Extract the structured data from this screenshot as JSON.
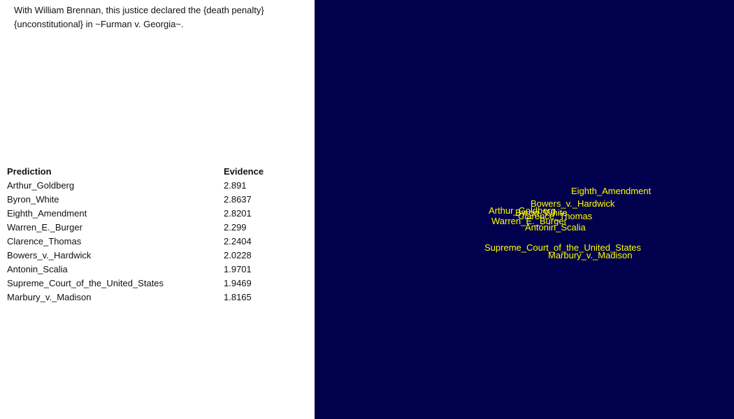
{
  "question": {
    "line1": "With William Brennan, this justice declared the {death penalty}",
    "line2": "{unconstitutional} in ~Furman v. Georgia~."
  },
  "table": {
    "headers": {
      "prediction": "Prediction",
      "evidence": "Evidence"
    },
    "rows": [
      {
        "prediction": "Arthur_Goldberg",
        "evidence": "2.891"
      },
      {
        "prediction": "Byron_White",
        "evidence": "2.8637"
      },
      {
        "prediction": "Eighth_Amendment",
        "evidence": "2.8201"
      },
      {
        "prediction": "Warren_E._Burger",
        "evidence": "2.299"
      },
      {
        "prediction": "Clarence_Thomas",
        "evidence": "2.2404"
      },
      {
        "prediction": "Bowers_v._Hardwick",
        "evidence": "2.0228"
      },
      {
        "prediction": "Antonin_Scalia",
        "evidence": "1.9701"
      },
      {
        "prediction": "Supreme_Court_of_the_United_States",
        "evidence": "1.9469"
      },
      {
        "prediction": "Marbury_v._Madison",
        "evidence": "1.8165"
      }
    ]
  },
  "map": {
    "background": "#00004d",
    "label_color": "#ffff00",
    "labels": {
      "eighth_amendment": "Eighth_Amendment",
      "bowers": "Bowers_v._Hardwick",
      "goldberg": "Arthur_Goldberg",
      "white": "Byron_White",
      "thomas": "Clarence_Thomas",
      "burger": "Warren_E._Burger",
      "scalia": "Antonin_Scalia",
      "supreme_court": "Supreme_Court_of_the_United_States",
      "marbury": "Marbury_v._Madison"
    }
  }
}
